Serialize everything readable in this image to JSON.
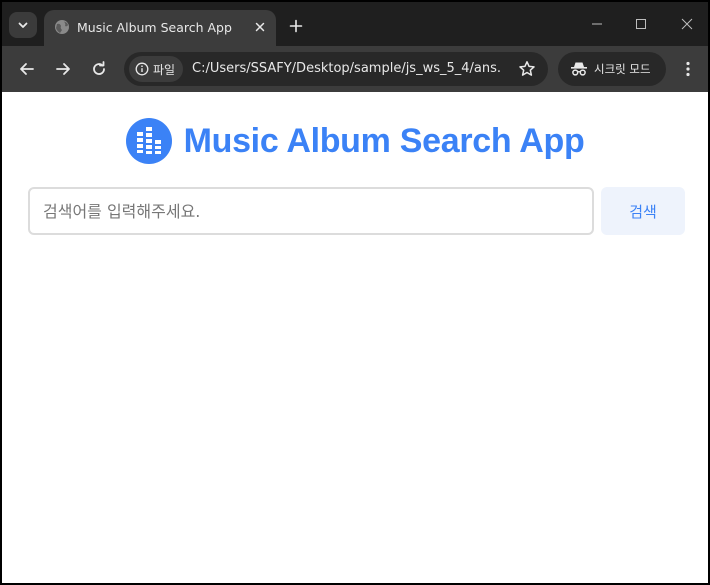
{
  "browser": {
    "tab_title": "Music Album Search App",
    "address_chip_label": "파일",
    "url": "C:/Users/SSAFY/Desktop/sample/js_ws_5_4/ans...",
    "incognito_label": "시크릿 모드"
  },
  "page": {
    "title": "Music Album Search App",
    "search": {
      "placeholder": "검색어를 입력해주세요.",
      "value": "",
      "button_label": "검색"
    }
  },
  "colors": {
    "accent": "#3b82f6",
    "search_button_bg": "#eef3fc",
    "titlebar_bg": "#1f1f1f",
    "toolbar_bg": "#3c3c3c"
  },
  "icons": {
    "logo": "music-equalizer-icon"
  }
}
